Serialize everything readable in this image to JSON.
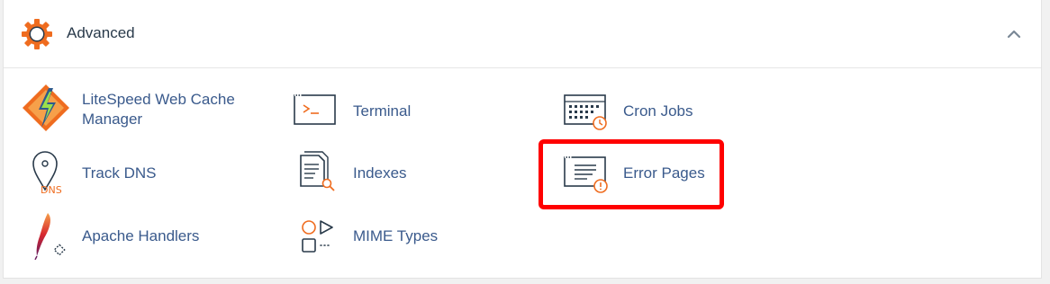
{
  "section": {
    "title": "Advanced",
    "icon": "gear-icon",
    "collapse_icon": "chevron-up-icon"
  },
  "items": [
    {
      "label": "LiteSpeed Web Cache Manager",
      "icon": "litespeed-icon"
    },
    {
      "label": "Terminal",
      "icon": "terminal-icon"
    },
    {
      "label": "Cron Jobs",
      "icon": "cron-calendar-icon"
    },
    {
      "label": "Track DNS",
      "icon": "dns-pin-icon"
    },
    {
      "label": "Indexes",
      "icon": "indexes-doc-icon"
    },
    {
      "label": "Error Pages",
      "icon": "error-page-icon",
      "highlighted": true
    },
    {
      "label": "Apache Handlers",
      "icon": "apache-feather-icon"
    },
    {
      "label": "MIME Types",
      "icon": "mime-shapes-icon"
    }
  ],
  "colors": {
    "accent_orange": "#ef6c1f",
    "link_blue": "#3a5a8c",
    "highlight_red": "#ff0000"
  }
}
